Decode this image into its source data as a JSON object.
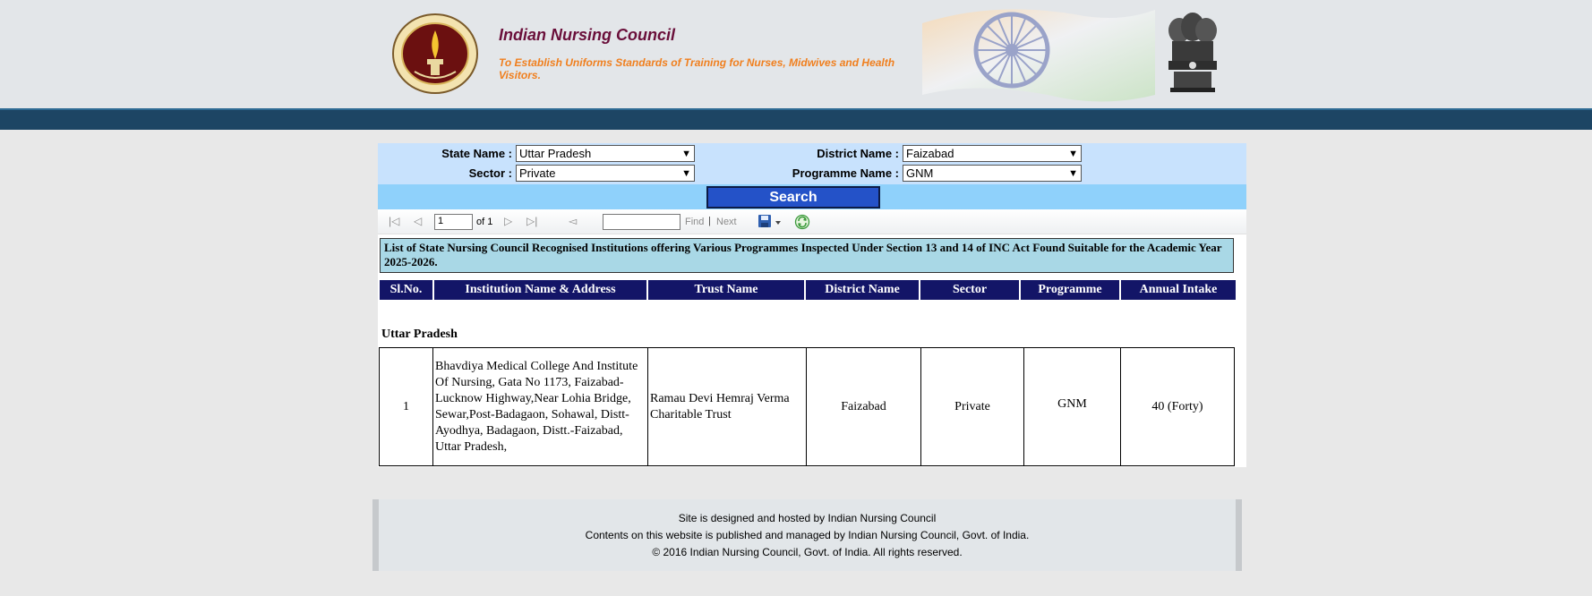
{
  "header": {
    "title": "Indian Nursing Council",
    "tagline": "To Establish Uniforms Standards of Training for Nurses, Midwives and Health Visitors."
  },
  "filters": {
    "state_label": "State Name :",
    "state_value": "Uttar Pradesh",
    "district_label": "District Name :",
    "district_value": "Faizabad",
    "sector_label": "Sector :",
    "sector_value": "Private",
    "programme_label": "Programme Name :",
    "programme_value": "GNM",
    "search_label": "Search"
  },
  "toolbar": {
    "page_value": "1",
    "of_text": "of 1",
    "find_label": "Find",
    "separator": "|",
    "next_label": "Next"
  },
  "report": {
    "title": "List of State Nursing Council Recognised Institutions offering Various Programmes Inspected Under Section 13 and 14 of INC Act Found Suitable for the Academic Year 2025-2026.",
    "columns": [
      "Sl.No.",
      "Institution Name & Address",
      "Trust Name",
      "District Name",
      "Sector",
      "Programme",
      "Annual Intake"
    ],
    "state_heading": "Uttar Pradesh",
    "rows": [
      {
        "sl": "1",
        "institution": "Bhavdiya Medical College And Institute Of Nursing, Gata No 1173, Faizabad-Lucknow Highway,Near Lohia Bridge, Sewar,Post-Badagaon, Sohawal, Distt-Ayodhya,  Badagaon, Distt.-Faizabad, Uttar Pradesh,",
        "trust": "Ramau Devi Hemraj Verma Charitable Trust",
        "district": "Faizabad",
        "sector": "Private",
        "programme": "GNM",
        "intake": "40 (Forty)"
      }
    ]
  },
  "footer": {
    "line1": "Site is designed and hosted by Indian Nursing Council",
    "line2": "Contents on this website is published and managed by Indian Nursing Council, Govt. of India.",
    "line3": "© 2016 Indian Nursing Council, Govt. of India. All rights reserved."
  },
  "colors": {
    "header_bg": "#e3e6e9",
    "band": "#1d4564",
    "title": "#6a0f3a",
    "tagline": "#f07f1e",
    "filter_bg": "#c8e2fd",
    "search_row_bg": "#8fd1fb",
    "search_button": "#2452c8",
    "column_header": "#131567",
    "report_title_bg": "#a9d8e6"
  },
  "icons": [
    "council-logo",
    "flag-chakra-art",
    "national-emblem",
    "first-page-icon",
    "prev-page-icon",
    "next-page-icon",
    "last-page-icon",
    "back-icon",
    "export-save-icon",
    "refresh-icon"
  ]
}
